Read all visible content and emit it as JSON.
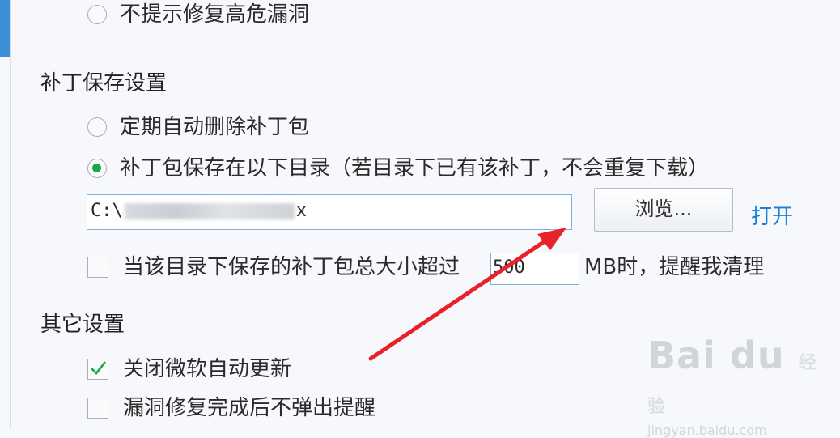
{
  "options": {
    "no_prompt_high_risk": "不提示修复高危漏洞"
  },
  "patch_save": {
    "title": "补丁保存设置",
    "auto_delete": "定期自动删除补丁包",
    "save_dir": "补丁包保存在以下目录（若目录下已有该补丁，不会重复下载）",
    "path_prefix": "C:\\",
    "path_suffix": "x",
    "browse_label": "浏览...",
    "open_label": "打开",
    "size_prefix": "当该目录下保存的补丁包总大小超过",
    "size_value": "500",
    "size_suffix": "MB时，提醒我清理"
  },
  "other": {
    "title": "其它设置",
    "disable_ms_update": "关闭微软自动更新",
    "no_popup_after_fix": "漏洞修复完成后不弹出提醒"
  },
  "watermark": {
    "logo": "Bai du",
    "sub": "经验",
    "url": "jingyan.baidu.com"
  },
  "colors": {
    "accent": "#1aa64a",
    "link": "#1e80d8",
    "arrow": "#e8212b"
  }
}
